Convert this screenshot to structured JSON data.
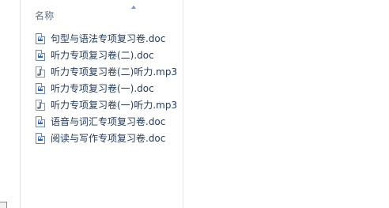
{
  "file_list": {
    "column_header": "名称",
    "items": [
      {
        "name": "句型与语法专项复习卷.doc",
        "icon": "word-document-icon"
      },
      {
        "name": "听力专项复习卷(二).doc",
        "icon": "word-document-icon"
      },
      {
        "name": "听力专项复习卷(二)听力.mp3",
        "icon": "audio-file-icon"
      },
      {
        "name": "听力专项复习卷(一).doc",
        "icon": "word-document-icon"
      },
      {
        "name": "听力专项复习卷(一)听力.mp3",
        "icon": "audio-file-icon"
      },
      {
        "name": "语音与词汇专项复习卷.doc",
        "icon": "word-document-icon"
      },
      {
        "name": "阅读与写作专项复习卷.doc",
        "icon": "word-document-icon"
      }
    ]
  },
  "colors": {
    "background": "#ffffff",
    "text": "#233b5c",
    "header_text": "#5f6f84",
    "separator": "#e1e8f2",
    "word_icon": "#2a63b8"
  }
}
